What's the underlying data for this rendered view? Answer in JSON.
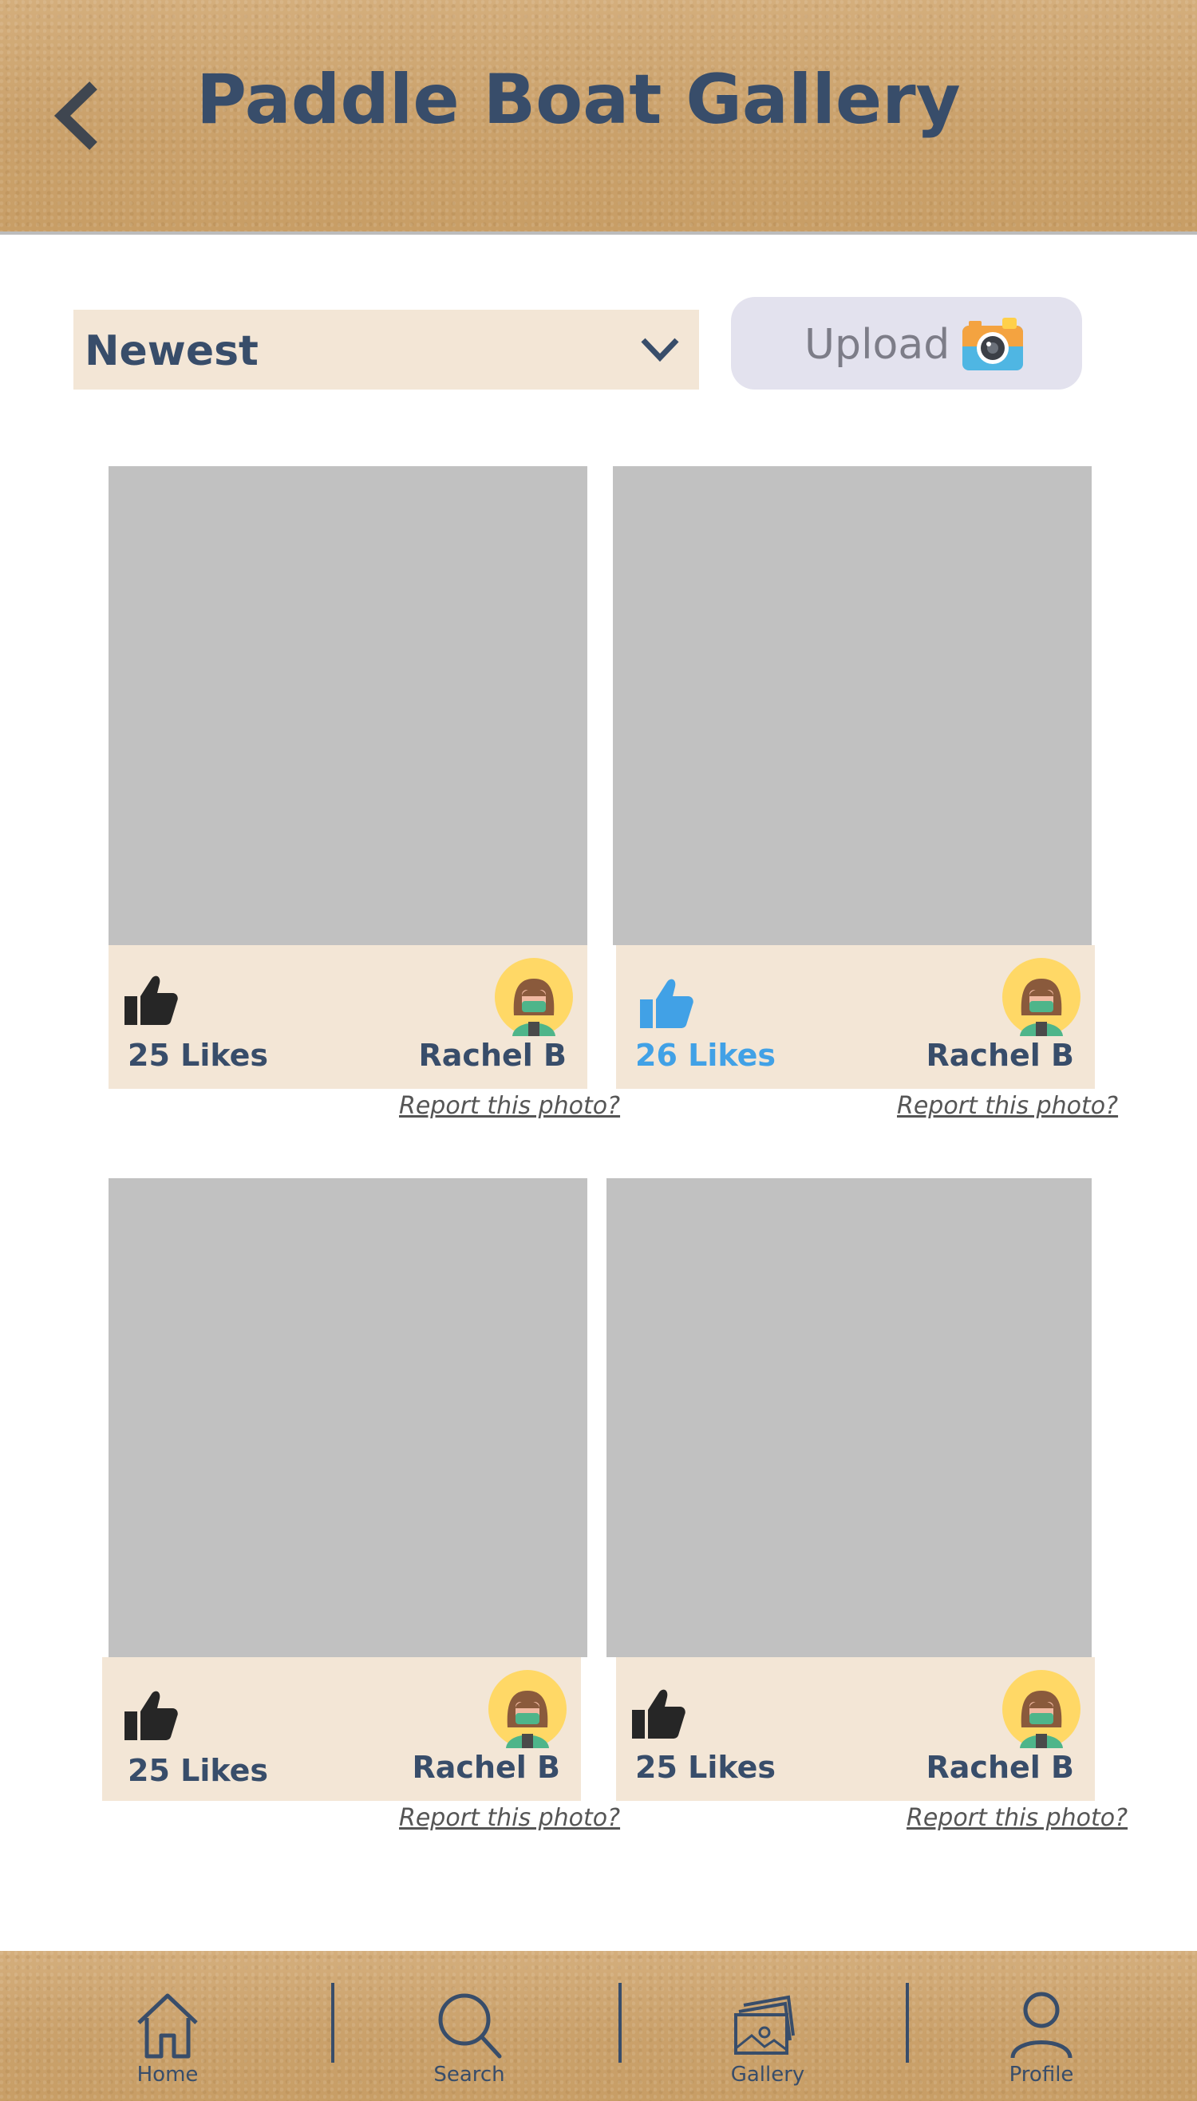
{
  "header": {
    "title": "Paddle Boat Gallery",
    "back_icon": "chevron-left-icon"
  },
  "controls": {
    "sort": {
      "selected": "Newest",
      "icon": "chevron-down-icon"
    },
    "upload": {
      "label": "Upload",
      "icon": "camera-icon"
    }
  },
  "photos": [
    {
      "likes": "25 Likes",
      "liked": false,
      "author": "Rachel B",
      "report": "Report this photo?"
    },
    {
      "likes": "26 Likes",
      "liked": true,
      "author": "Rachel B",
      "report": "Report this photo?"
    },
    {
      "likes": "25 Likes",
      "liked": false,
      "author": "Rachel B",
      "report": "Report this photo?"
    },
    {
      "likes": "25 Likes",
      "liked": false,
      "author": "Rachel B",
      "report": "Report this photo?"
    }
  ],
  "colors": {
    "primary_text": "#384d6a",
    "liked_blue": "#41a1e6",
    "card_bg": "#f3e6d6",
    "photo_placeholder": "#c1c1c1",
    "upload_bg": "#e3e2ee"
  },
  "nav": {
    "items": [
      {
        "label": "Home",
        "icon": "home-icon"
      },
      {
        "label": "Search",
        "icon": "search-icon"
      },
      {
        "label": "Gallery",
        "icon": "gallery-icon"
      },
      {
        "label": "Profile",
        "icon": "profile-icon"
      }
    ]
  }
}
